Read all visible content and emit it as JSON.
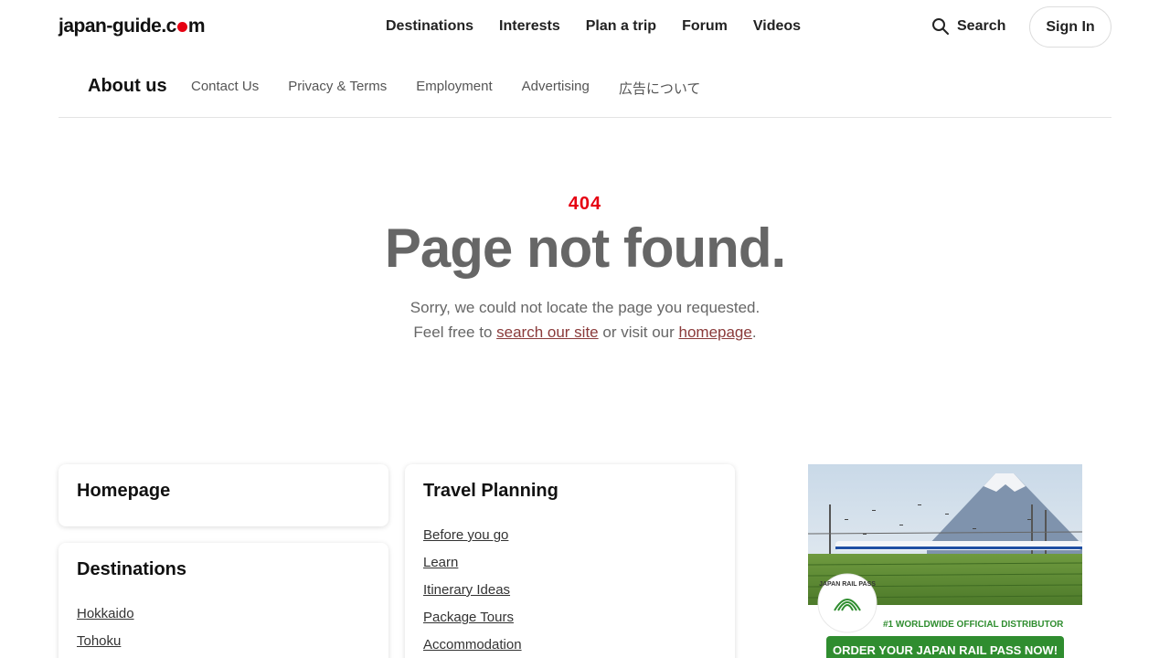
{
  "logo": {
    "text_before": "japan-guide.c",
    "text_after": "m"
  },
  "main_nav": [
    "Destinations",
    "Interests",
    "Plan a trip",
    "Forum",
    "Videos"
  ],
  "search_label": "Search",
  "sign_in_label": "Sign In",
  "sub_nav": {
    "title": "About us",
    "links": [
      "Contact Us",
      "Privacy & Terms",
      "Employment",
      "Advertising",
      "広告について"
    ]
  },
  "error": {
    "code": "404",
    "heading": "Page not found.",
    "line1": "Sorry, we could not locate the page you requested.",
    "line2_prefix": "Feel free to ",
    "search_link": "search our site",
    "line2_middle": " or visit our ",
    "homepage_link": "homepage",
    "line2_suffix": "."
  },
  "cards": {
    "homepage": {
      "title": "Homepage"
    },
    "destinations": {
      "title": "Destinations",
      "links": [
        "Hokkaido",
        "Tohoku"
      ]
    },
    "travel_planning": {
      "title": "Travel Planning",
      "links": [
        "Before you go",
        "Learn",
        "Itinerary Ideas",
        "Package Tours",
        "Accommodation"
      ]
    }
  },
  "ad": {
    "badge_text": "JAPAN RAIL PASS",
    "tagline": "#1 WORLDWIDE OFFICIAL DISTRIBUTOR",
    "button": "ORDER YOUR JAPAN RAIL PASS NOW!"
  },
  "colors": {
    "accent_red": "#e60012",
    "ad_green": "#2f8d2f",
    "link_underline": "#8a3a3a"
  }
}
